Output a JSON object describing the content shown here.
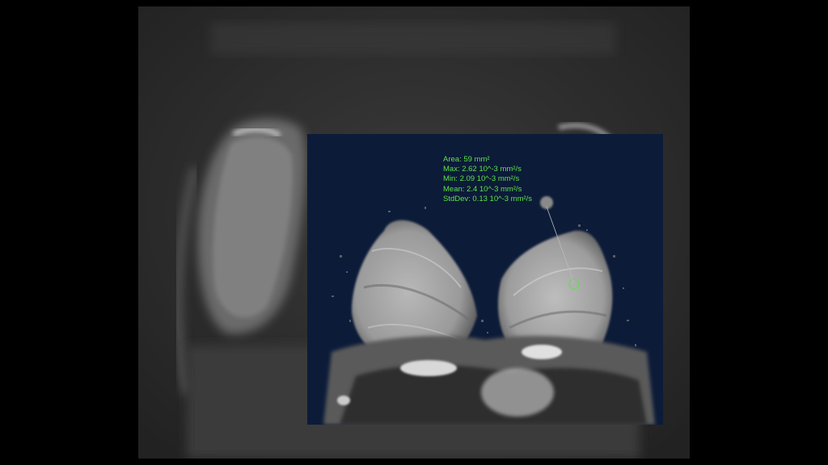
{
  "measurement": {
    "area": "Area: 59 mm²",
    "max": "Max: 2.62 10^-3 mm²/s",
    "min": "Min: 2.09 10^-3 mm²/s",
    "mean": "Mean: 2.4 10^-3 mm²/s",
    "stddev": "StdDev: 0.13 10^-3 mm²/s"
  },
  "colors": {
    "page_background": "#000000",
    "background_scan": "#2a2a2a",
    "inset_background": "#0c1b38",
    "annotation_text": "#5ee04a"
  }
}
